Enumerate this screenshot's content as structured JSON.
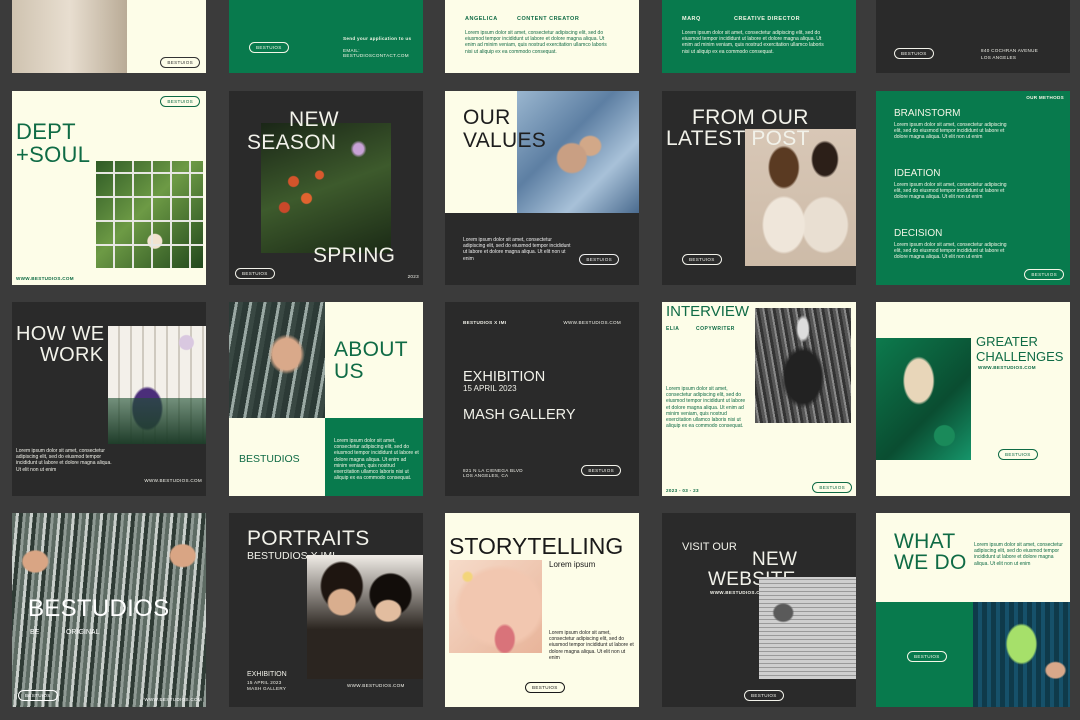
{
  "common": {
    "pill": "BESTUIOS",
    "web": "WWW.BESTUDIOS.COM",
    "lorem": "Lorem ipsum dolor sit amet, consectetur adipiscing elit, sed do eiusmod tempor incididunt ut labore et dolore magna aliqua. Ut enim ad minim veniam, quis nostrud exercitation ullamco laboris nisi ut aliquip ex ea commodo consequat.",
    "lorem_short": "Lorem ipsum dolor sit amet, consectetur adipiscing elit, sed do eiusmod tempor incididunt ut labore et dolore magna aliqua. Ut elit non ut enim"
  },
  "row1": {
    "c2_send": "Send your application to us",
    "c2_email": "EMAIL: BESTUDIOSCONTACT.COM",
    "c3_name": "ANGELICA",
    "c3_role": "CONTENT CREATOR",
    "c4_name": "MARQ",
    "c4_role": "CREATIVE DIRECTOR",
    "c5_addr1": "840 COCHRAN AVENUE",
    "c5_addr2": "LOS ANGELES"
  },
  "row2": {
    "c1_title1": "DEPT",
    "c1_title2": "+SOUL",
    "c2_title1": "NEW",
    "c2_title2": "SEASON",
    "c2_bottom": "SPRING",
    "c2_year": "2023",
    "c3_title1": "OUR",
    "c3_title2": "VALUES",
    "c4_title1": "FROM OUR",
    "c4_title2": "LATEST POST",
    "c5_tag": "OUR METHODS",
    "c5_h1": "BRAINSTORM",
    "c5_h2": "IDEATION",
    "c5_h3": "DECISION"
  },
  "row3": {
    "c1_title1": "HOW WE",
    "c1_title2": "WORK",
    "c2_title1": "ABOUT",
    "c2_title2": "US",
    "c2_brand": "BESTUDIOS",
    "c3_top": "BESTUDIOS X IMI",
    "c3_web": "WWW.BESTUDIOS.COM",
    "c3_h1": "EXHIBITION",
    "c3_date": "15 APRIL 2023",
    "c3_h2": "MASH GALLERY",
    "c3_addr": "821 N LA CIENEGA BLVD LOS ANGELES, CA",
    "c4_title": "INTERVIEW",
    "c4_name": "ELIA",
    "c4_role": "COPYWRITER",
    "c4_date": "2023 - 03 - 23",
    "c5_title1": "GREATER",
    "c5_title2": "CHALLENGES"
  },
  "row4": {
    "c1_brand": "BESTUDIOS",
    "c1_be": "BE",
    "c1_orig": "ORIGINAL",
    "c2_title": "PORTRAITS",
    "c2_sub": "BESTUDIOS X IMI",
    "c2_exh": "EXHIBITION",
    "c2_exh2": "15 APRIL 2023",
    "c2_exh3": "MASH GALLERY",
    "c3_title": "STORYTELLING",
    "c3_sub": "Lorem ipsum",
    "c4_visit": "VISIT OUR",
    "c4_new": "NEW",
    "c4_website": "WEBSITE",
    "c5_title1": "WHAT",
    "c5_title2": "WE DO"
  }
}
